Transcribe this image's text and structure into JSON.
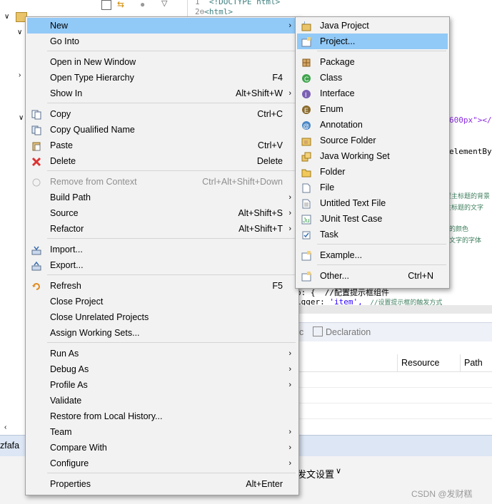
{
  "editor": {
    "lines": [
      {
        "num": "1",
        "text": "<!DOCTYPE html>"
      },
      {
        "num": "2",
        "text": "<html>"
      }
    ],
    "fragments": {
      "px600": "600px\"></",
      "elementBy": "elementById",
      "c1": "置主标题的背景",
      "c2": "主标题的文字",
      "c3": "的颜色",
      "c4": "文字的字体",
      "p_line": "p: {  //配置提示框组件",
      "trigger_key": "igger: ",
      "trigger_val": "'item',",
      "trigger_cmt": "  //设置提示框的触发方式"
    }
  },
  "bottom_panel": {
    "tabs": [
      "oc",
      "Declaration"
    ],
    "columns": [
      "Resource",
      "Path"
    ]
  },
  "status": {
    "project_fragment": "zfafa"
  },
  "bottom_bar": {
    "text": "发文设置",
    "watermark": "CSDN @发财糕"
  },
  "context_menu": {
    "items": [
      {
        "label": "New",
        "shortcut": "",
        "submenu": true,
        "icon": "",
        "selected": true
      },
      {
        "label": "Go Into",
        "shortcut": "",
        "submenu": false,
        "icon": ""
      },
      {
        "label": "Open in New Window",
        "shortcut": "",
        "submenu": false,
        "icon": ""
      },
      {
        "label": "Open Type Hierarchy",
        "shortcut": "F4",
        "submenu": false,
        "icon": ""
      },
      {
        "label": "Show In",
        "shortcut": "Alt+Shift+W",
        "submenu": true,
        "icon": ""
      },
      {
        "label": "Copy",
        "shortcut": "Ctrl+C",
        "submenu": false,
        "icon": "copy-icon"
      },
      {
        "label": "Copy Qualified Name",
        "shortcut": "",
        "submenu": false,
        "icon": "copy-qualified-icon"
      },
      {
        "label": "Paste",
        "shortcut": "Ctrl+V",
        "submenu": false,
        "icon": "paste-icon"
      },
      {
        "label": "Delete",
        "shortcut": "Delete",
        "submenu": false,
        "icon": "delete-icon"
      },
      {
        "label": "Remove from Context",
        "shortcut": "Ctrl+Alt+Shift+Down",
        "submenu": false,
        "icon": "remove-context-icon",
        "disabled": true
      },
      {
        "label": "Build Path",
        "shortcut": "",
        "submenu": true,
        "icon": ""
      },
      {
        "label": "Source",
        "shortcut": "Alt+Shift+S",
        "submenu": true,
        "icon": ""
      },
      {
        "label": "Refactor",
        "shortcut": "Alt+Shift+T",
        "submenu": true,
        "icon": ""
      },
      {
        "label": "Import...",
        "shortcut": "",
        "submenu": false,
        "icon": "import-icon"
      },
      {
        "label": "Export...",
        "shortcut": "",
        "submenu": false,
        "icon": "export-icon"
      },
      {
        "label": "Refresh",
        "shortcut": "F5",
        "submenu": false,
        "icon": "refresh-icon"
      },
      {
        "label": "Close Project",
        "shortcut": "",
        "submenu": false,
        "icon": ""
      },
      {
        "label": "Close Unrelated Projects",
        "shortcut": "",
        "submenu": false,
        "icon": ""
      },
      {
        "label": "Assign Working Sets...",
        "shortcut": "",
        "submenu": false,
        "icon": ""
      },
      {
        "label": "Run As",
        "shortcut": "",
        "submenu": true,
        "icon": ""
      },
      {
        "label": "Debug As",
        "shortcut": "",
        "submenu": true,
        "icon": ""
      },
      {
        "label": "Profile As",
        "shortcut": "",
        "submenu": true,
        "icon": ""
      },
      {
        "label": "Validate",
        "shortcut": "",
        "submenu": false,
        "icon": ""
      },
      {
        "label": "Restore from Local History...",
        "shortcut": "",
        "submenu": false,
        "icon": ""
      },
      {
        "label": "Team",
        "shortcut": "",
        "submenu": true,
        "icon": ""
      },
      {
        "label": "Compare With",
        "shortcut": "",
        "submenu": true,
        "icon": ""
      },
      {
        "label": "Configure",
        "shortcut": "",
        "submenu": true,
        "icon": ""
      },
      {
        "label": "Properties",
        "shortcut": "Alt+Enter",
        "submenu": false,
        "icon": ""
      }
    ]
  },
  "new_submenu": {
    "items": [
      {
        "label": "Java Project",
        "shortcut": "",
        "icon": "java-project-icon"
      },
      {
        "label": "Project...",
        "shortcut": "",
        "icon": "project-icon",
        "selected": true
      },
      {
        "label": "Package",
        "shortcut": "",
        "icon": "package-icon"
      },
      {
        "label": "Class",
        "shortcut": "",
        "icon": "class-icon"
      },
      {
        "label": "Interface",
        "shortcut": "",
        "icon": "interface-icon"
      },
      {
        "label": "Enum",
        "shortcut": "",
        "icon": "enum-icon"
      },
      {
        "label": "Annotation",
        "shortcut": "",
        "icon": "annotation-icon"
      },
      {
        "label": "Source Folder",
        "shortcut": "",
        "icon": "source-folder-icon"
      },
      {
        "label": "Java Working Set",
        "shortcut": "",
        "icon": "working-set-icon"
      },
      {
        "label": "Folder",
        "shortcut": "",
        "icon": "folder-icon"
      },
      {
        "label": "File",
        "shortcut": "",
        "icon": "file-icon"
      },
      {
        "label": "Untitled Text File",
        "shortcut": "",
        "icon": "text-file-icon"
      },
      {
        "label": "JUnit Test Case",
        "shortcut": "",
        "icon": "junit-icon"
      },
      {
        "label": "Task",
        "shortcut": "",
        "icon": "task-icon"
      },
      {
        "label": "Example...",
        "shortcut": "",
        "icon": "example-icon"
      },
      {
        "label": "Other...",
        "shortcut": "Ctrl+N",
        "icon": "other-icon"
      }
    ]
  }
}
